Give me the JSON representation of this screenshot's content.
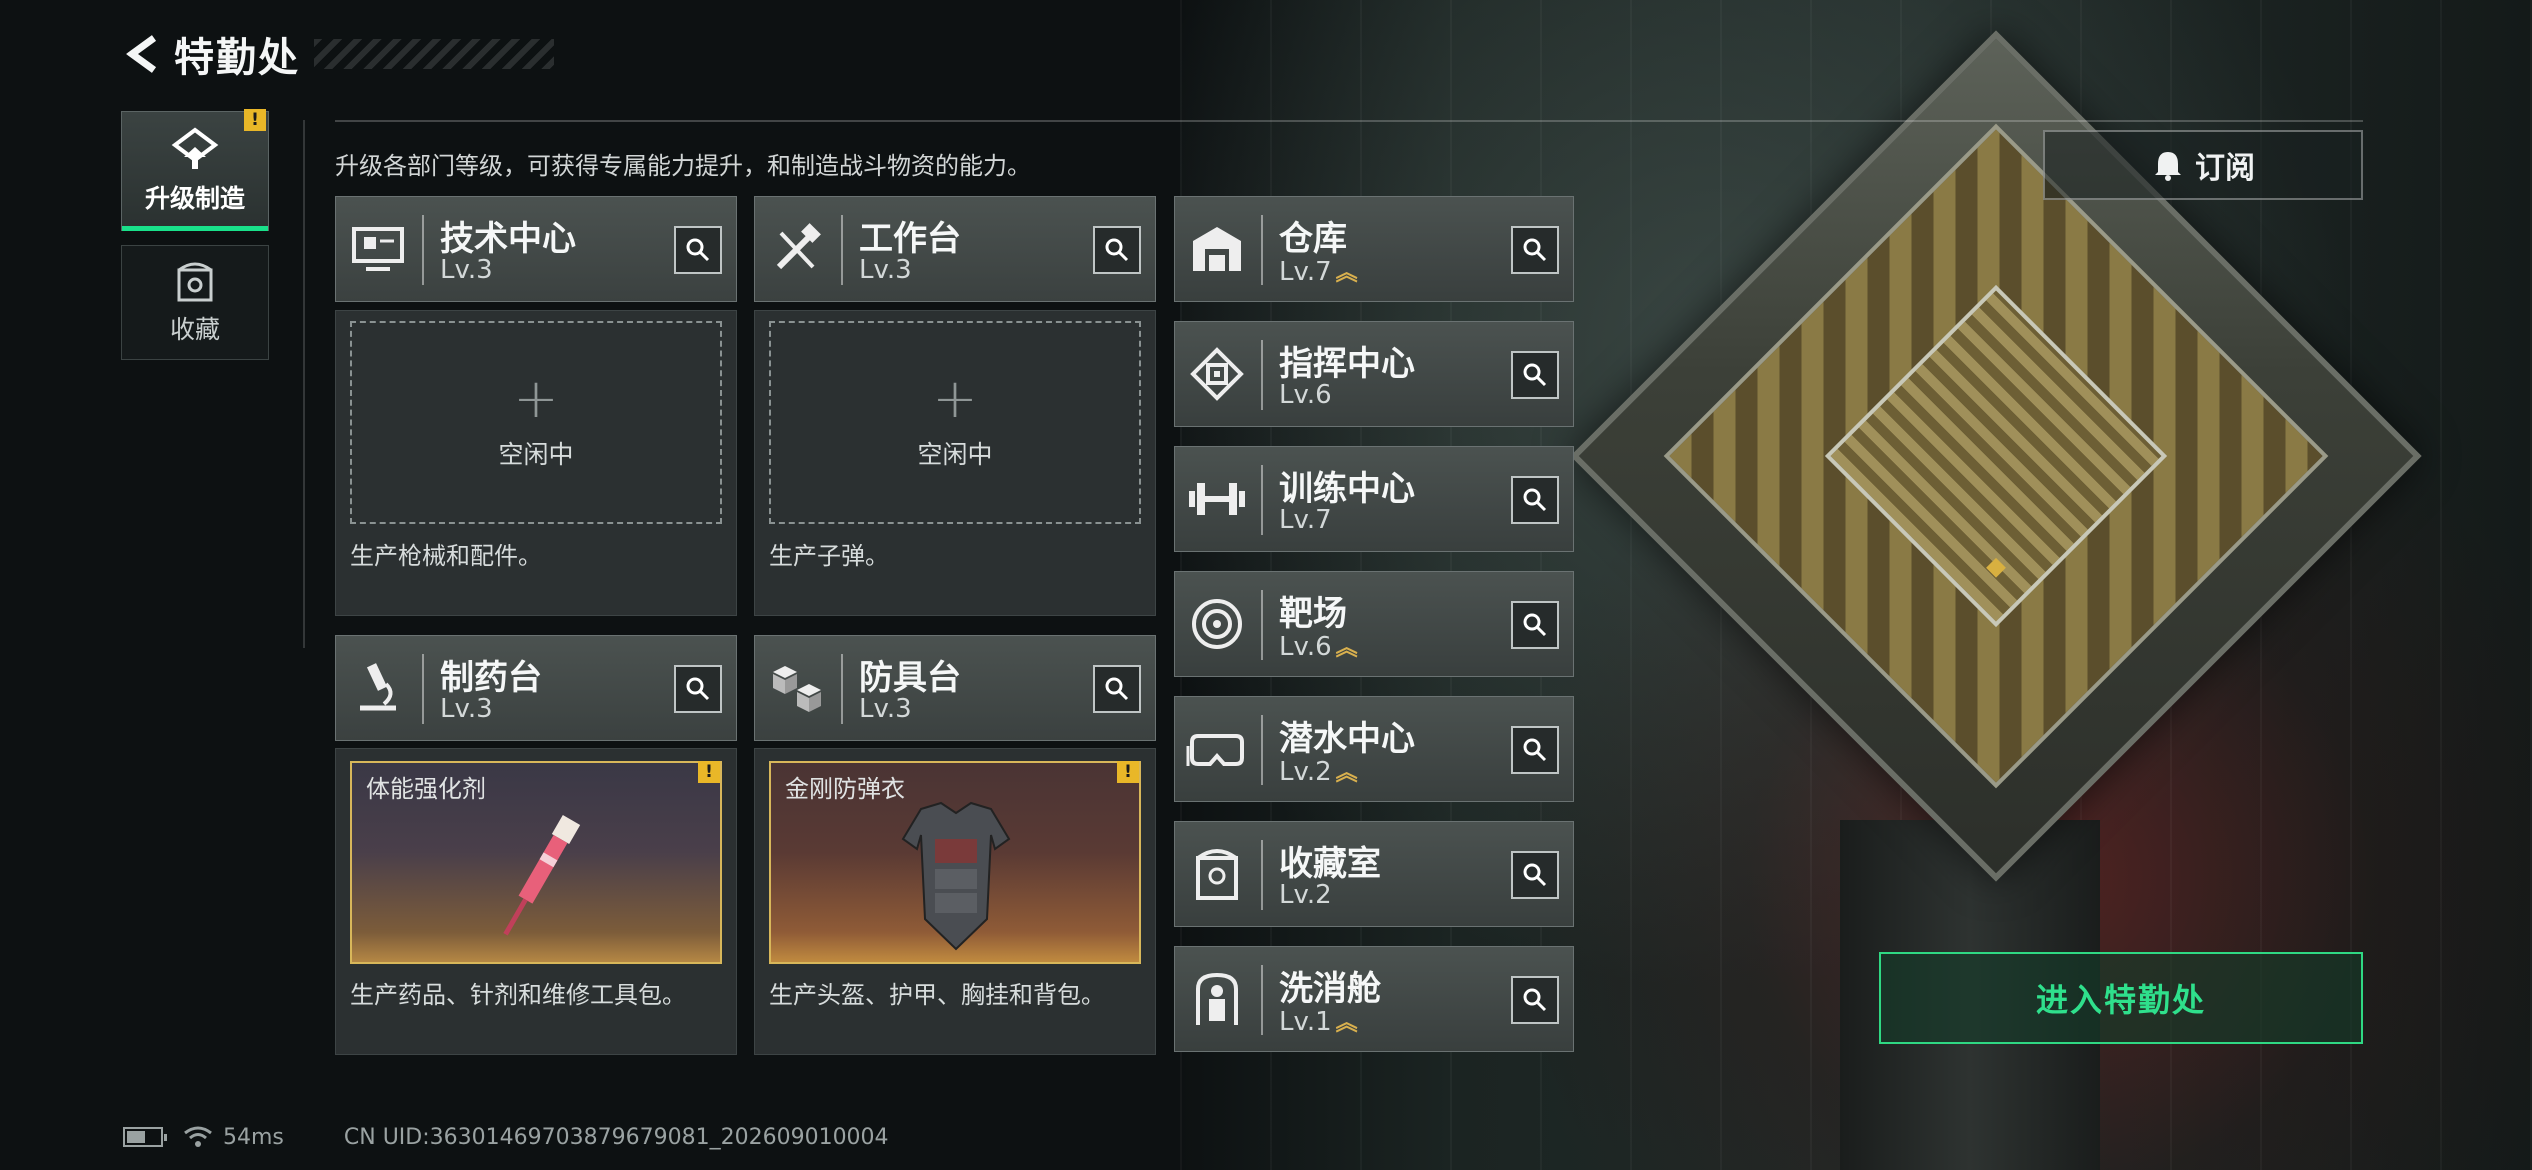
{
  "header": {
    "title": "特勤处"
  },
  "sidebar": {
    "tabs": [
      {
        "label": "升级制造",
        "active": true,
        "alert": "!"
      },
      {
        "label": "收藏",
        "active": false
      }
    ]
  },
  "description": "升级各部门等级，可获得专属能力提升，和制造战斗物资的能力。",
  "workshops": [
    {
      "name": "技术中心",
      "level": "Lv.3",
      "icon": "computer-icon",
      "slot": {
        "state": "idle",
        "plus": "+",
        "status": "空闲中"
      },
      "desc": "生产枪械和配件。"
    },
    {
      "name": "工作台",
      "level": "Lv.3",
      "icon": "tools-icon",
      "slot": {
        "state": "idle",
        "plus": "+",
        "status": "空闲中"
      },
      "desc": "生产子弹。"
    },
    {
      "name": "制药台",
      "level": "Lv.3",
      "icon": "microscope-icon",
      "slot": {
        "state": "item",
        "item_name": "体能强化剂",
        "alert": "!"
      },
      "desc": "生产药品、针剂和维修工具包。"
    },
    {
      "name": "防具台",
      "level": "Lv.3",
      "icon": "cubes-icon",
      "slot": {
        "state": "item",
        "item_name": "金刚防弹衣",
        "alert": "!"
      },
      "desc": "生产头盔、护甲、胸挂和背包。"
    }
  ],
  "departments": [
    {
      "name": "仓库",
      "level": "Lv.7",
      "upgradable": true,
      "icon": "warehouse-icon"
    },
    {
      "name": "指挥中心",
      "level": "Lv.6",
      "upgradable": false,
      "icon": "command-chip-icon"
    },
    {
      "name": "训练中心",
      "level": "Lv.7",
      "upgradable": false,
      "icon": "dumbbell-icon"
    },
    {
      "name": "靶场",
      "level": "Lv.6",
      "upgradable": true,
      "icon": "target-icon"
    },
    {
      "name": "潜水中心",
      "level": "Lv.2",
      "upgradable": true,
      "icon": "diving-mask-icon"
    },
    {
      "name": "收藏室",
      "level": "Lv.2",
      "upgradable": false,
      "icon": "trophy-case-icon"
    },
    {
      "name": "洗消舱",
      "level": "Lv.1",
      "upgradable": true,
      "icon": "decon-suit-icon"
    }
  ],
  "upgrade_symbol": "︽",
  "subscribe_label": "订阅",
  "enter_label": "进入特勤处",
  "status": {
    "battery_level": 0.55,
    "ping": "54ms",
    "uid": "CN UID:36301469703879679081_202609010004"
  },
  "colors": {
    "accent_green": "#2fe08c",
    "alert_yellow": "#e9b728",
    "item_border": "#d8b75a"
  }
}
